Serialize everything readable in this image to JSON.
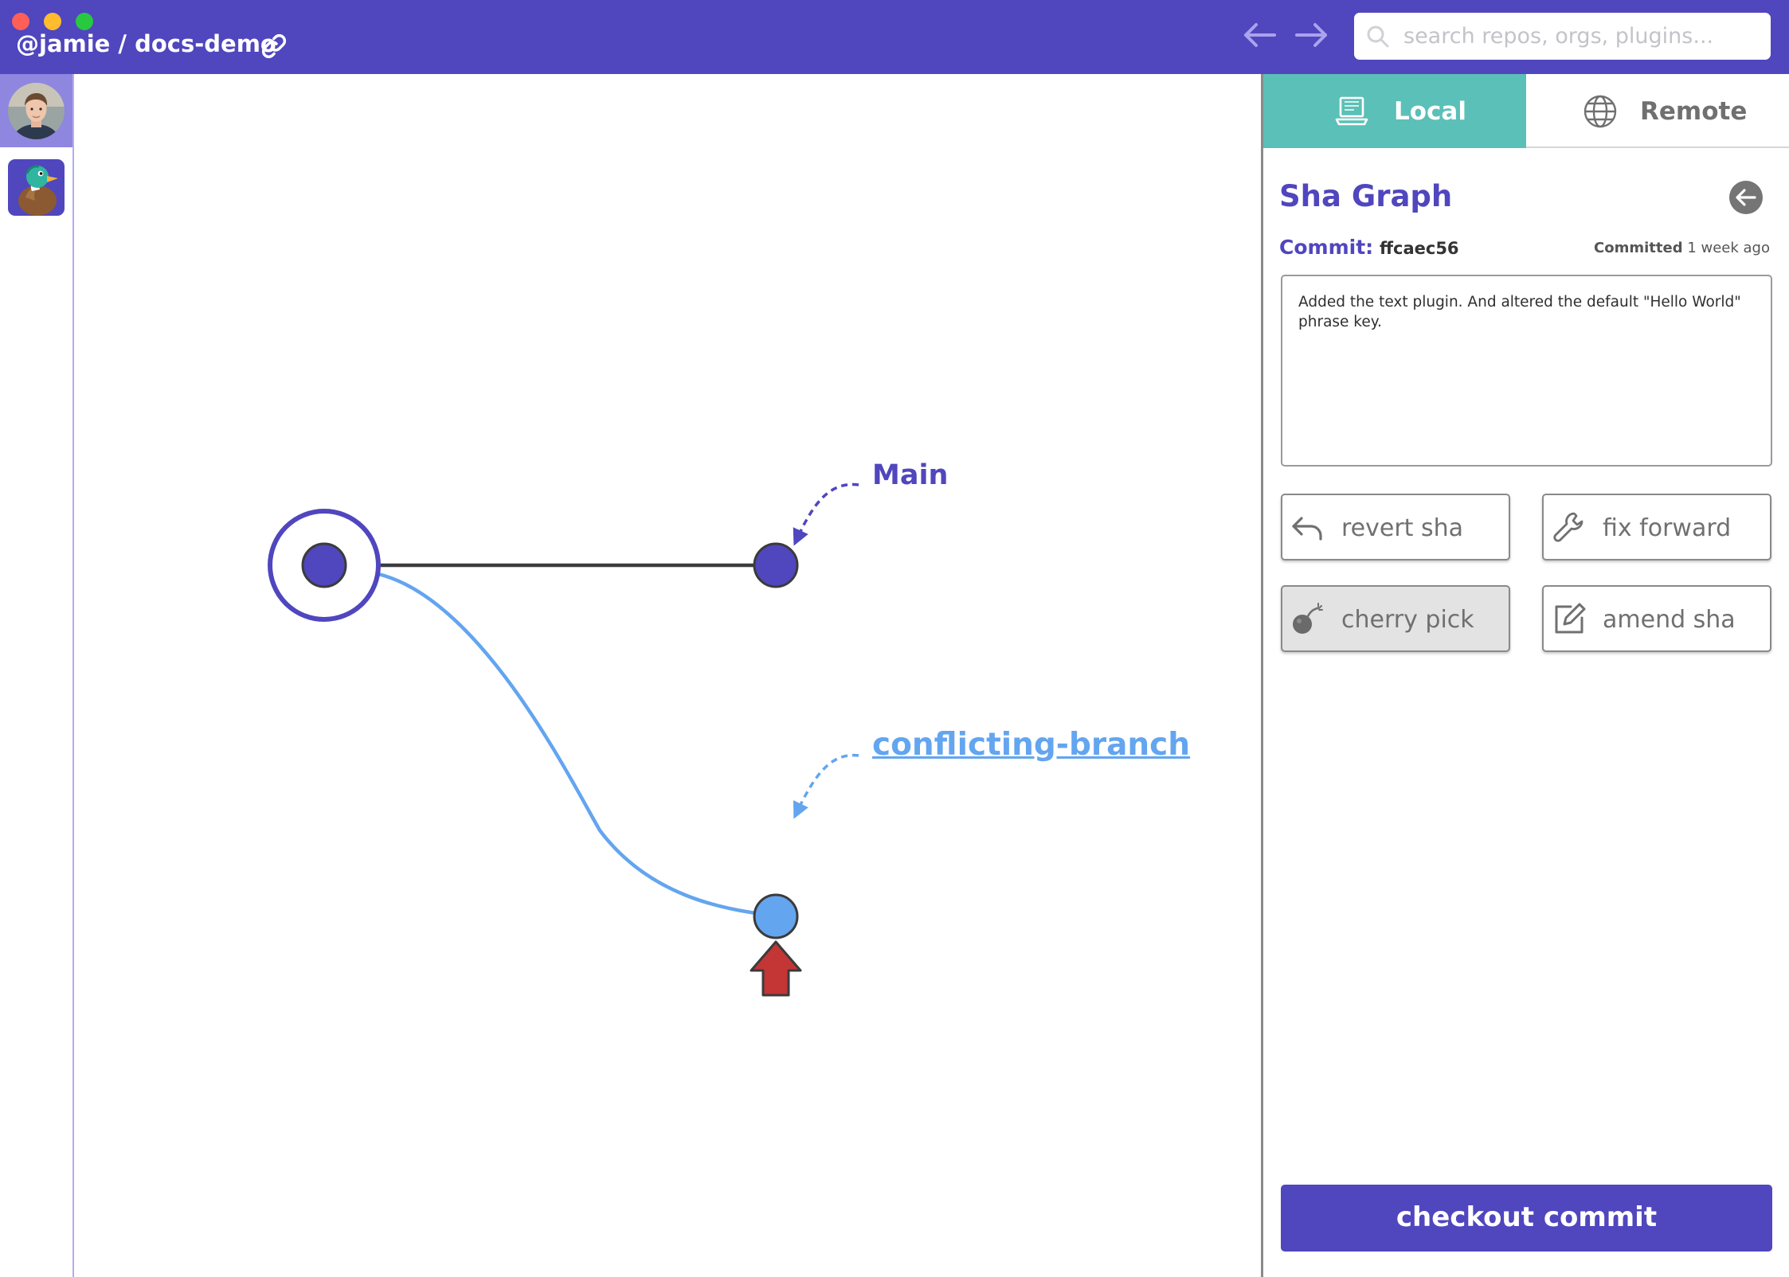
{
  "window": {
    "repo_title": "@jamie / docs-demo"
  },
  "search": {
    "placeholder": "search repos, orgs, plugins..."
  },
  "graph": {
    "branches": [
      {
        "label": "Main",
        "color": "#5046be"
      },
      {
        "label": "conflicting-branch",
        "color": "#63a5ef"
      }
    ],
    "head_marker_color": "#c43535"
  },
  "panel": {
    "tabs": [
      {
        "label": "Local",
        "icon": "laptop-icon",
        "active": true
      },
      {
        "label": "Remote",
        "icon": "globe-icon",
        "active": false
      }
    ],
    "title": "Sha Graph",
    "commit_label": "Commit:",
    "commit_sha": "ffcaec56",
    "committed_label": "Committed",
    "committed_time": "1 week ago",
    "commit_message": "Added the text plugin. And altered the default \"Hello World\" phrase key.",
    "actions": [
      {
        "label": "revert sha",
        "icon": "undo-arrow-icon",
        "disabled": false
      },
      {
        "label": "fix forward",
        "icon": "wrench-icon",
        "disabled": false
      },
      {
        "label": "cherry pick",
        "icon": "cherry-bomb-icon",
        "disabled": true
      },
      {
        "label": "amend sha",
        "icon": "edit-icon",
        "disabled": false
      }
    ],
    "checkout_label": "checkout commit"
  },
  "colors": {
    "brand": "#5046be",
    "accent_teal": "#5bc0b7",
    "branch_blue": "#63a5ef",
    "rail_active": "#8f86e0"
  }
}
